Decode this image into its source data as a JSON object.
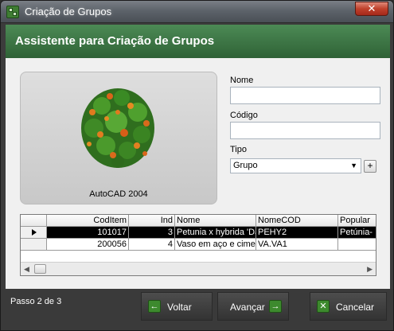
{
  "window": {
    "title": "Criação de Grupos",
    "close_glyph": "✕"
  },
  "header": {
    "title": "Assistente para Criação de Grupos"
  },
  "preview": {
    "caption": "AutoCAD 2004"
  },
  "form": {
    "nome_label": "Nome",
    "nome_value": "",
    "codigo_label": "Código",
    "codigo_value": "",
    "tipo_label": "Tipo",
    "tipo_selected": "Grupo",
    "add_label": "+"
  },
  "grid": {
    "columns": [
      "CodItem",
      "Ind",
      "Nome",
      "NomeCOD",
      "Popular"
    ],
    "rows": [
      [
        "101017",
        "3",
        "Petunia x hybrida 'Da",
        "PEHY2",
        "Petúnia-"
      ],
      [
        "200056",
        "4",
        "Vaso em aço e cimen",
        "VA.VA1",
        ""
      ]
    ]
  },
  "footer": {
    "step_text": "Passo 2  de 3",
    "back_label": "Voltar",
    "next_label": "Avançar",
    "cancel_label": "Cancelar"
  },
  "colors": {
    "header_green": "#2f6236",
    "button_icon_green": "#3d8a2e",
    "footer_bg": "#3a3a3a"
  },
  "icons": {
    "app": "app-icon",
    "back": "arrow-left-icon",
    "next": "arrow-right-icon",
    "cancel": "close-x-icon",
    "dropdown": "chevron-down-icon",
    "row_indicator": "row-pointer-icon"
  }
}
